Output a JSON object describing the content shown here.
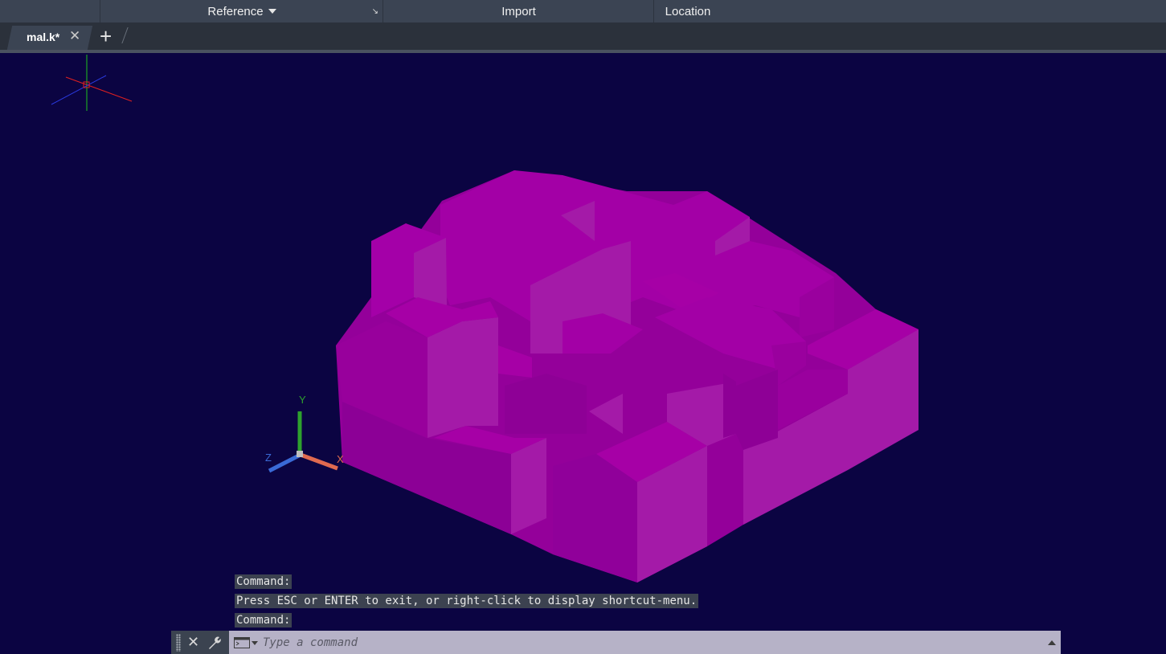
{
  "ribbon": {
    "panels": [
      {
        "label": "Reference"
      },
      {
        "label": "Import"
      },
      {
        "label": "Location"
      }
    ]
  },
  "tabs": {
    "active": {
      "label": "mal.k*"
    }
  },
  "ucs": {
    "x": "X",
    "y": "Y",
    "z": "Z"
  },
  "command_history": [
    "Command:",
    "Press ESC or ENTER to exit, or right-click to display shortcut-menu.",
    "Command:"
  ],
  "command_bar": {
    "placeholder": "Type a command"
  },
  "colors": {
    "viewport_bg": "#0b0442",
    "solid_top": "#a600a6",
    "solid_left": "#94009a",
    "solid_right": "#a41aa8"
  },
  "icons": [
    "chevron-down-icon",
    "dialog-launcher-icon",
    "close-icon",
    "plus-icon",
    "grip-icon",
    "wrench-icon",
    "command-prompt-icon",
    "chevron-up-icon"
  ]
}
